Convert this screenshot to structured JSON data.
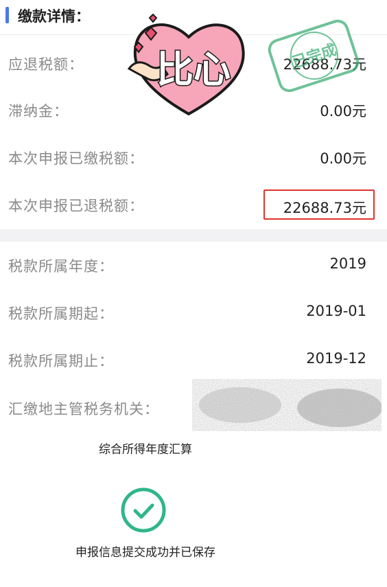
{
  "section": {
    "title": "缴款详情："
  },
  "payment_rows": [
    {
      "label": "应退税额：",
      "value": "22688.73元"
    },
    {
      "label": "滞纳金：",
      "value": "0.00元"
    },
    {
      "label": "本次申报已缴税额：",
      "value": "0.00元"
    },
    {
      "label": "本次申报已退税额：",
      "value": "22688.73元"
    }
  ],
  "period_rows": [
    {
      "label": "税款所属年度：",
      "value": "2019"
    },
    {
      "label": "税款所属期起：",
      "value": "2019-01"
    },
    {
      "label": "税款所属期止：",
      "value": "2019-12"
    },
    {
      "label": "汇缴地主管税务机关：",
      "value": ""
    }
  ],
  "stamp": {
    "text": "已完成",
    "color": "#3fae76"
  },
  "sticker": {
    "text": "比心",
    "heart_color": "#f6a6b8",
    "outline_color": "#1a1a1a"
  },
  "summary": {
    "title": "综合所得年度汇算",
    "status": "申报信息提交成功并已保存",
    "success_color": "#2fb68a"
  },
  "highlight_color": "#e0322d"
}
